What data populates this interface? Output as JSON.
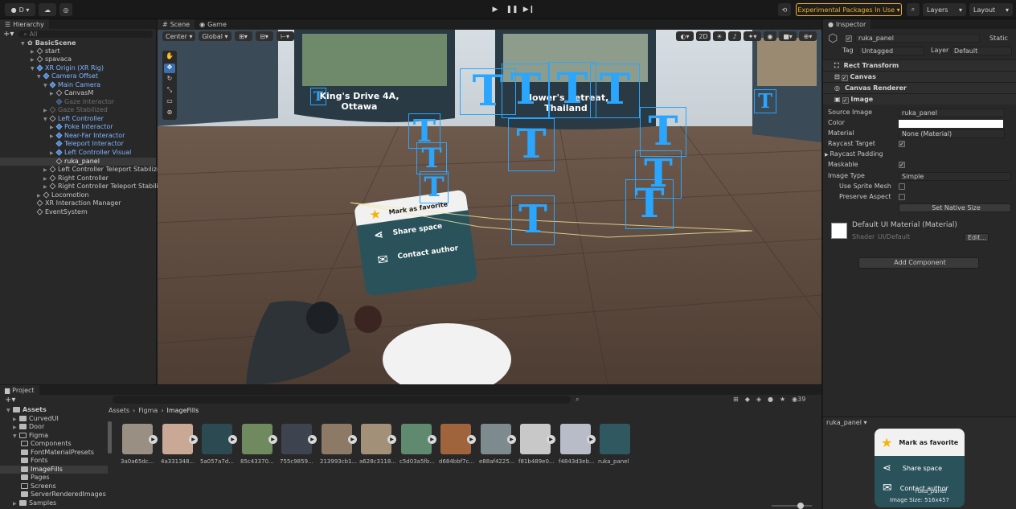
{
  "topbar": {
    "account_label": "D ▾",
    "cloud_icon": "cloud-icon",
    "experimental_label": "Experimental Packages In Use ▾",
    "layers_label": "Layers",
    "layout_label": "Layout",
    "accent": "#f0b020"
  },
  "hierarchy": {
    "tab": "Hierarchy",
    "search_placeholder": "All",
    "items": [
      {
        "label": "BasicScene"
      },
      {
        "label": "start"
      },
      {
        "label": "spavaca"
      },
      {
        "label": "XR Origin (XR Rig)"
      },
      {
        "label": "Camera Offset"
      },
      {
        "label": "Main Camera"
      },
      {
        "label": "CanvasM"
      },
      {
        "label": "Gaze Interactor"
      },
      {
        "label": "Gaze Stabilized"
      },
      {
        "label": "Left Controller"
      },
      {
        "label": "Poke Interactor"
      },
      {
        "label": "Near-Far Interactor"
      },
      {
        "label": "Teleport Interactor"
      },
      {
        "label": "Left Controller Visual"
      },
      {
        "label": "ruka_panel"
      },
      {
        "label": "Left Controller Teleport Stabilize"
      },
      {
        "label": "Right Controller"
      },
      {
        "label": "Right Controller Teleport Stabiliz"
      },
      {
        "label": "Locomotion"
      },
      {
        "label": "XR Interaction Manager"
      },
      {
        "label": "EventSystem"
      }
    ]
  },
  "scene": {
    "tab_scene": "Scene",
    "tab_game": "Game",
    "pivot_label": "Center ▾",
    "space_label": "Global ▾",
    "mode_2d": "2D",
    "card_left_line1": "King's Drive 4A,",
    "card_left_line2": "Ottawa",
    "card_center_line1": "Flower's Retreat,",
    "card_center_line2": "Thailand",
    "text_glyph": "T",
    "panel_items": [
      "Mark as favorite",
      "Share space",
      "Contact author"
    ]
  },
  "inspector": {
    "tab": "Inspector",
    "object_name": "ruka_panel",
    "static_label": "Static",
    "tag_label": "Tag",
    "tag_value": "Untagged",
    "layer_label": "Layer",
    "layer_value": "Default",
    "components": [
      "Rect Transform",
      "Canvas",
      "Canvas Renderer",
      "Image"
    ],
    "fields": {
      "source_image_label": "Source Image",
      "source_image_value": "ruka_panel",
      "color_label": "Color",
      "material_label": "Material",
      "material_value": "None (Material)",
      "raycast_target_label": "Raycast Target",
      "raycast_padding_label": "Raycast Padding",
      "maskable_label": "Maskable",
      "image_type_label": "Image Type",
      "image_type_value": "Simple",
      "use_sprite_mesh_label": "Use Sprite Mesh",
      "preserve_aspect_label": "Preserve Aspect",
      "set_native_size": "Set Native Size"
    },
    "material_name": "Default UI Material (Material)",
    "shader_label": "Shader",
    "shader_value": "UI/Default",
    "edit_label": "Edit...",
    "add_component": "Add Component",
    "preview_title": "ruka_panel ▾",
    "preview_items": [
      "Mark as favorite",
      "Share space",
      "Contact author"
    ],
    "preview_overlay_name": "ruka_panel",
    "image_size": "Image Size: 516x457"
  },
  "project": {
    "tab": "Project",
    "count": "39",
    "breadcrumb": [
      "Assets",
      "Figma",
      "ImageFills"
    ],
    "tree": [
      {
        "label": "Assets"
      },
      {
        "label": "CurvedUI"
      },
      {
        "label": "Door"
      },
      {
        "label": "Figma"
      },
      {
        "label": "Components"
      },
      {
        "label": "FontMaterialPresets"
      },
      {
        "label": "Fonts"
      },
      {
        "label": "ImageFills"
      },
      {
        "label": "Pages"
      },
      {
        "label": "Screens"
      },
      {
        "label": "ServerRenderedImages"
      },
      {
        "label": "Samples"
      }
    ],
    "assets": [
      {
        "label": "3a0a65dc...",
        "color": "#9a8f83"
      },
      {
        "label": "4a331348...",
        "color": "#c9a896"
      },
      {
        "label": "5a057a7d...",
        "color": "#2b4a52"
      },
      {
        "label": "85c43370...",
        "color": "#6f8a5e"
      },
      {
        "label": "755c9859...",
        "color": "#3d4450"
      },
      {
        "label": "213993cb1...",
        "color": "#8c7a66"
      },
      {
        "label": "a628c3118...",
        "color": "#a39078"
      },
      {
        "label": "c5d03a5fb...",
        "color": "#5f8a70"
      },
      {
        "label": "d684bbf7c...",
        "color": "#a0643c"
      },
      {
        "label": "e88af4225...",
        "color": "#7d8a8e"
      },
      {
        "label": "f81b489e0...",
        "color": "#c8c8c8"
      },
      {
        "label": "f4843d3eb...",
        "color": "#b8bcc8"
      },
      {
        "label": "ruka_panel",
        "color": "#2f5860"
      }
    ]
  }
}
